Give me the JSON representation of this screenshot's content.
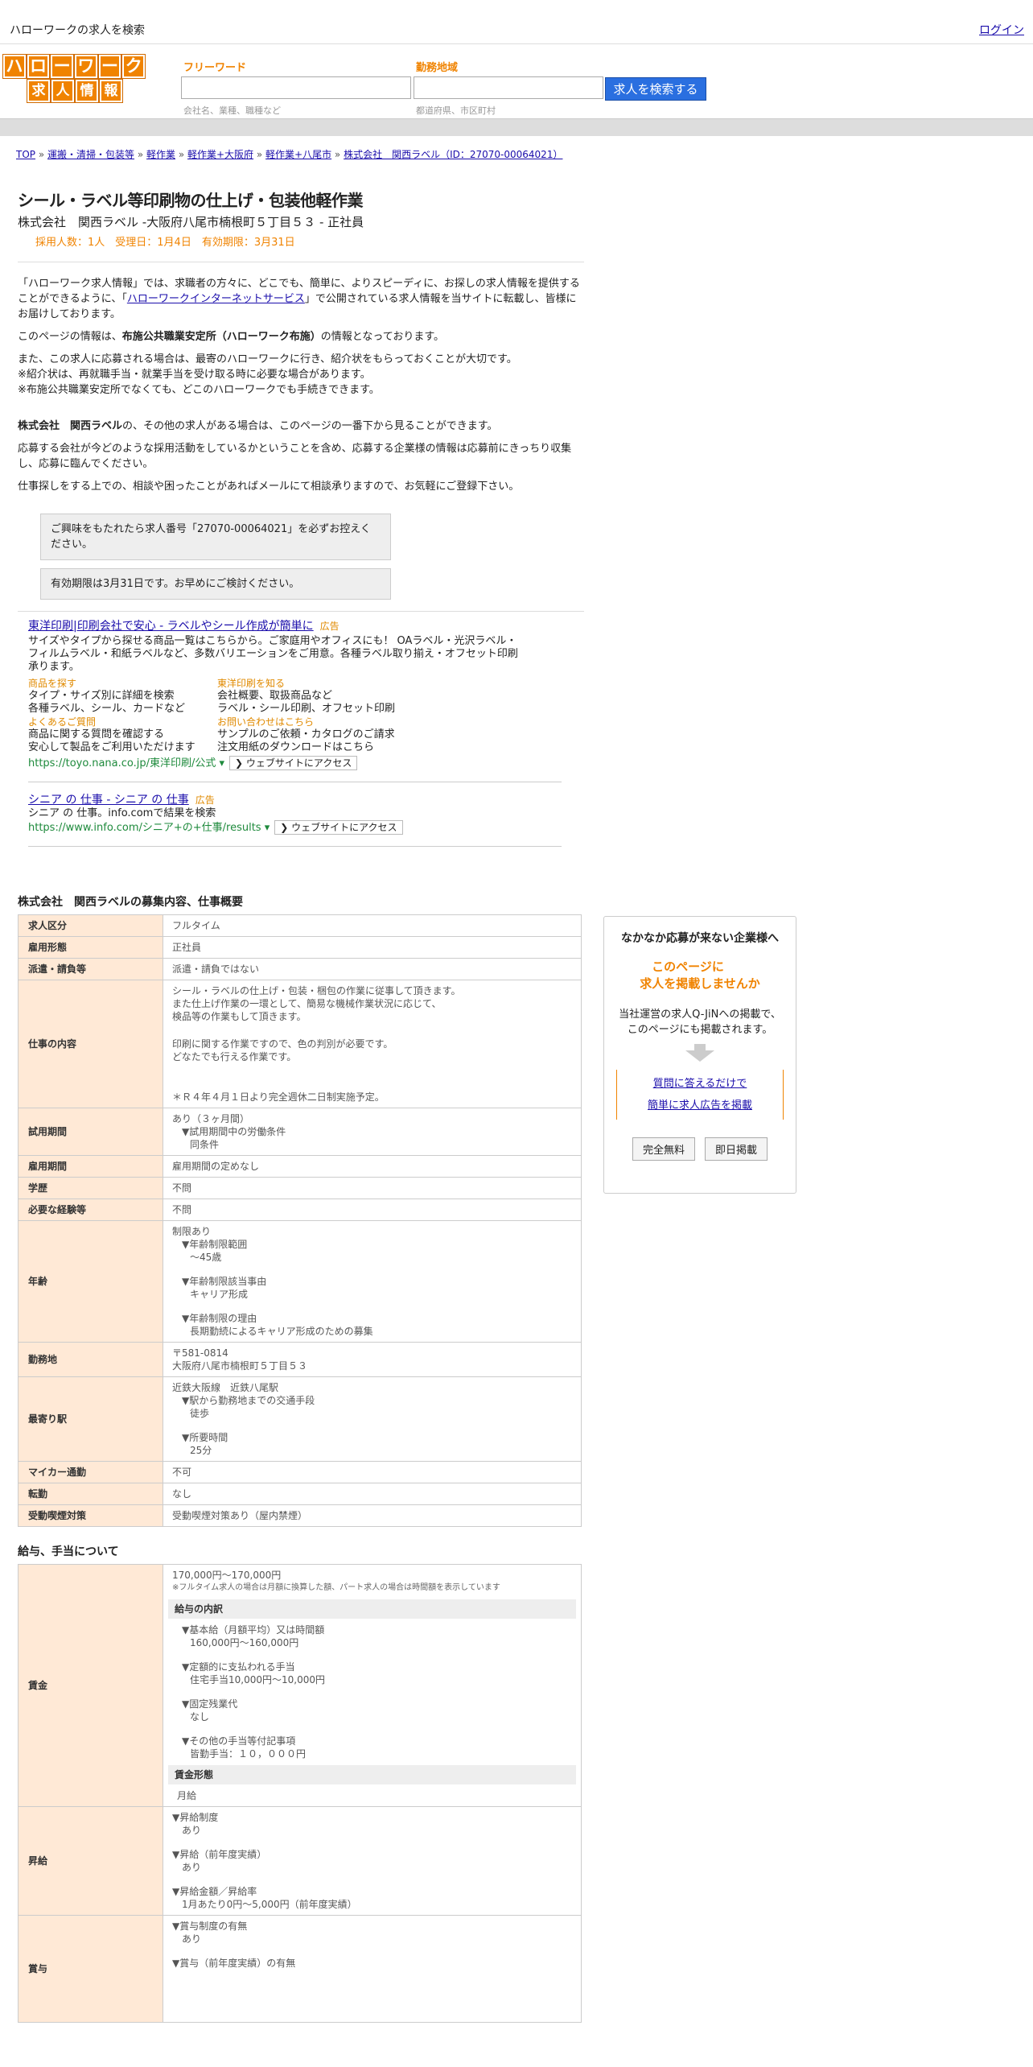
{
  "top": {
    "site_title": "ハローワークの求人を検索",
    "login": "ログイン"
  },
  "logo": {
    "row1": [
      "ハ",
      "ロ",
      "ー",
      "ワ",
      "ー",
      "ク"
    ],
    "row2": [
      "求",
      "人",
      "情",
      "報"
    ]
  },
  "search": {
    "freeword_label": "フリーワード",
    "freeword_placeholder": "会社名、業種、職種など",
    "area_label": "勤務地域",
    "area_placeholder": "都道府県、市区町村",
    "button": "求人を検索する"
  },
  "breadcrumb": {
    "items": [
      "TOP",
      "運搬・清掃・包装等",
      "軽作業",
      "軽作業+大阪府",
      "軽作業+八尾市",
      "株式会社　関西ラベル（ID：27070-00064021）"
    ],
    "sep": " » "
  },
  "job": {
    "title": "シール・ラベル等印刷物の仕上げ・包装他軽作業",
    "company_line": "株式会社　関西ラベル -大阪府八尾市楠根町５丁目５３ - 正社員",
    "recruit_line": "採用人数：1人　受理日：1月4日　有効期限：3月31日"
  },
  "intro": {
    "p1a": "「ハローワーク求人情報」では、求職者の方々に、どこでも、簡単に、よりスピーディに、お探しの求人情報を提供することができるように、「",
    "p1link": "ハローワークインターネットサービス",
    "p1b": "」で公開されている求人情報を当サイトに転載し、皆様にお届けしております。",
    "p2a": "このページの情報は、",
    "p2b": "布施公共職業安定所（ハローワーク布施）",
    "p2c": "の情報となっております。",
    "p3": "また、この求人に応募される場合は、最寄のハローワークに行き、紹介状をもらっておくことが大切です。",
    "p3b": "※紹介状は、再就職手当・就業手当を受け取る時に必要な場合があります。",
    "p3c": "※布施公共職業安定所でなくても、どこのハローワークでも手続きできます。",
    "p4a": "株式会社　関西ラベル",
    "p4b": "の、その他の求人がある場合は、このページの一番下から見ることができます。",
    "p5": "応募する会社が今どのような採用活動をしているかということを含め、応募する企業様の情報は応募前にきっちり収集し、応募に臨んでください。",
    "p6": "仕事探しをする上での、相談や困ったことがあればメールにて相談承りますので、お気軽にご登録下さい。",
    "notice1": "ご興味をもたれたら求人番号「27070-00064021」を必ずお控えください。",
    "notice2": "有効期限は3月31日です。お早めにご検討ください。"
  },
  "ads": {
    "ad1": {
      "title": "東洋印刷|印刷会社で安心 - ラベルやシール作成が簡単に",
      "tag": "広告",
      "desc": "サイズやタイプから探せる商品一覧はこちらから。ご家庭用やオフィスにも！ OAラベル・光沢ラベル・フィルムラベル・和紙ラベルなど、多数バリエーションをご用意。各種ラベル取り揃え・オフセット印刷承ります。",
      "links": [
        {
          "h": "商品を探す",
          "l1": "タイプ・サイズ別に詳細を検索",
          "l2": "各種ラベル、シール、カードなど"
        },
        {
          "h": "東洋印刷を知る",
          "l1": "会社概要、取扱商品など",
          "l2": "ラベル・シール印刷、オフセット印刷"
        },
        {
          "h": "よくあるご質問",
          "l1": "商品に関する質問を確認する",
          "l2": "安心して製品をご利用いただけます"
        },
        {
          "h": "お問い合わせはこちら",
          "l1": "サンプルのご依頼・カタログのご請求",
          "l2": "注文用紙のダウンロードはこちら"
        }
      ],
      "url": "https://toyo.nana.co.jp/東洋印刷/公式",
      "visit": "❯ ウェブサイトにアクセス"
    },
    "ad2": {
      "title": "シニア の 仕事 - シニア の 仕事",
      "tag": "広告",
      "desc": "シニア の 仕事。info.comで結果を検索",
      "url": "https://www.info.com/シニア+の+仕事/results",
      "visit": "❯ ウェブサイトにアクセス"
    }
  },
  "summary": {
    "heading": "株式会社　関西ラベルの募集内容、仕事概要",
    "rows": {
      "kubun": {
        "k": "求人区分",
        "v": "フルタイム"
      },
      "keitai": {
        "k": "雇用形態",
        "v": "正社員"
      },
      "haken": {
        "k": "派遣・請負等",
        "v": "派遣・請負ではない"
      },
      "naiyo": {
        "k": "仕事の内容",
        "v1": "シール・ラベルの仕上げ・包装・梱包の作業に従事して頂きます。",
        "v2": "また仕上げ作業の一環として、簡易な機械作業状況に応じて、",
        "v3": "検品等の作業もして頂きます。",
        "v4": "印刷に関する作業ですので、色の判別が必要です。",
        "v5": "どなたでも行える作業です。",
        "v6": "＊Ｒ４年４月１日より完全週休二日制実施予定。"
      },
      "shiyo": {
        "k": "試用期間",
        "v1": "あり（３ヶ月間）",
        "v2": "▼試用期間中の労働条件",
        "v3": "同条件"
      },
      "kikan": {
        "k": "雇用期間",
        "v": "雇用期間の定めなし"
      },
      "gakureki": {
        "k": "学歴",
        "v": "不問"
      },
      "keiken": {
        "k": "必要な経験等",
        "v": "不問"
      },
      "nenrei": {
        "k": "年齢",
        "v1": "制限あり",
        "v2": "▼年齢制限範囲",
        "v3": "〜45歳",
        "v4": "▼年齢制限該当事由",
        "v5": "キャリア形成",
        "v6": "▼年齢制限の理由",
        "v7": "長期勤続によるキャリア形成のための募集"
      },
      "kinmuchi": {
        "k": "勤務地",
        "v1": "〒581-0814",
        "v2": "大阪府八尾市楠根町５丁目５３"
      },
      "eki": {
        "k": "最寄り駅",
        "v1": "近鉄大阪線　近鉄八尾駅",
        "v2": "▼駅から勤務地までの交通手段",
        "v3": "徒歩",
        "v4": "▼所要時間",
        "v5": "25分"
      },
      "mycar": {
        "k": "マイカー通勤",
        "v": "不可"
      },
      "tenkin": {
        "k": "転勤",
        "v": "なし"
      },
      "kitsuen": {
        "k": "受動喫煙対策",
        "v": "受動喫煙対策あり（屋内禁煙）"
      }
    }
  },
  "salary": {
    "heading": "給与、手当について",
    "chingin": {
      "k": "賃金",
      "range": "170,000円〜170,000円",
      "note": "※フルタイム求人の場合は月額に換算した額、パート求人の場合は時間額を表示しています",
      "bar1": "給与の内訳",
      "i1": "▼基本給（月額平均）又は時間額",
      "i1v": "160,000円〜160,000円",
      "i2": "▼定額的に支払われる手当",
      "i2v": "住宅手当10,000円〜10,000円",
      "i3": "▼固定残業代",
      "i3v": "なし",
      "i4": "▼その他の手当等付記事項",
      "i4v": "皆勤手当：１０，０００円",
      "bar2": "賃金形態",
      "form": "月給"
    },
    "shokyu": {
      "k": "昇給",
      "a": "▼昇給制度",
      "av": "あり",
      "b": "▼昇給（前年度実績）",
      "bv": "あり",
      "c": "▼昇給金額／昇給率",
      "cv": "1月あたり0円〜5,000円（前年度実績）"
    },
    "shoyo": {
      "k": "賞与",
      "a": "▼賞与制度の有無",
      "av": "あり",
      "b": "▼賞与（前年度実績）の有無"
    }
  },
  "side": {
    "title": "なかなか応募が来ない企業様へ",
    "offer1": "このページに",
    "offer2": "求人を掲載しませんか",
    "desc1": "当社運営の求人Q-JiNへの掲載で、",
    "desc2": "このページにも掲載されます。",
    "link1": "質問に答えるだけで",
    "link2": "簡単に求人広告を掲載",
    "btn1": "完全無料",
    "btn2": "即日掲載"
  }
}
